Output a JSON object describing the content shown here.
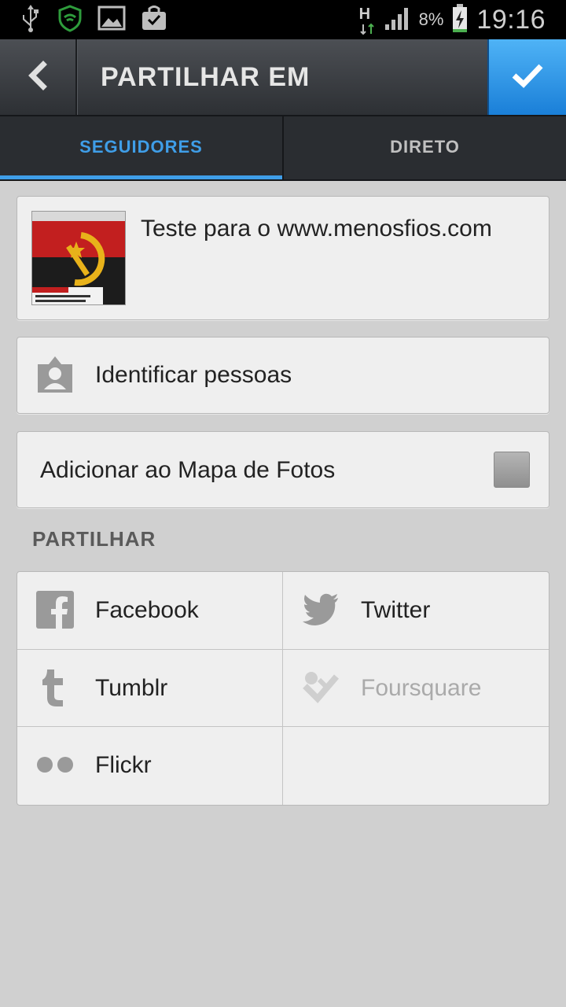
{
  "status_bar": {
    "network": "H",
    "battery_pct": "8%",
    "time": "19:16"
  },
  "action_bar": {
    "title": "PARTILHAR EM"
  },
  "tabs": [
    {
      "label": "SEGUIDORES",
      "active": true
    },
    {
      "label": "DIRETO",
      "active": false
    }
  ],
  "post": {
    "caption": "Teste para o www.menosfios.com"
  },
  "tag_people": {
    "label": "Identificar pessoas"
  },
  "photo_map": {
    "label": "Adicionar ao Mapa de Fotos",
    "checked": false
  },
  "share": {
    "title": "PARTILHAR",
    "services": [
      {
        "label": "Facebook",
        "icon": "facebook-icon",
        "enabled": true
      },
      {
        "label": "Twitter",
        "icon": "twitter-icon",
        "enabled": true
      },
      {
        "label": "Tumblr",
        "icon": "tumblr-icon",
        "enabled": true
      },
      {
        "label": "Foursquare",
        "icon": "foursquare-icon",
        "enabled": false
      },
      {
        "label": "Flickr",
        "icon": "flickr-icon",
        "enabled": true
      }
    ]
  },
  "colors": {
    "accent": "#3f9ee8",
    "confirm": "#1a7fd8"
  }
}
